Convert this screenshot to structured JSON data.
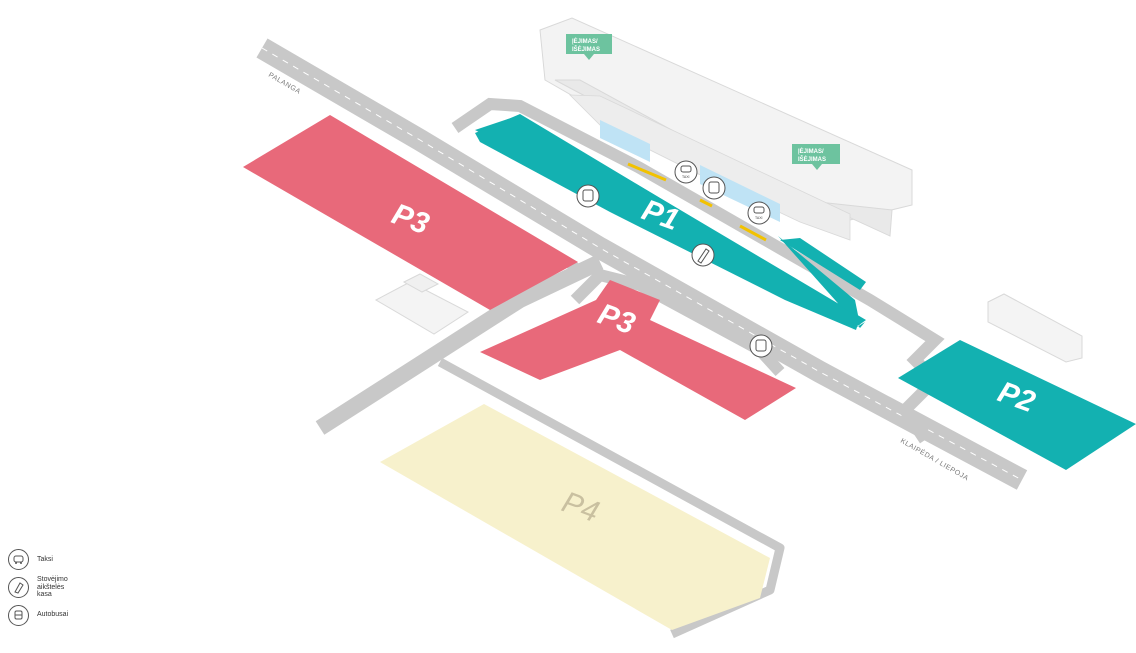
{
  "zones": {
    "p1": "P1",
    "p2": "P2",
    "p3_west": "P3",
    "p3_south": "P3",
    "p4": "P4"
  },
  "roads": {
    "north": "PALANGA",
    "south": "KLAIPĖDA / LIEPOJA"
  },
  "entrances": [
    {
      "line1": "ĮĖJIMAS/",
      "line2": "IŠĖJIMAS"
    },
    {
      "line1": "ĮĖJIMAS/",
      "line2": "IŠĖJIMAS"
    }
  ],
  "pins": {
    "taxi_text": "TAXI"
  },
  "legend": [
    {
      "icon": "taxi-icon",
      "label": "Taksi"
    },
    {
      "icon": "parking-ticket-icon",
      "label": "Stovėjimo\naikštelės\nkasa"
    },
    {
      "icon": "bus-icon",
      "label": "Autobusai"
    }
  ],
  "colors": {
    "p1_p2": "#13b1b1",
    "p3": "#e8697a",
    "p4": "#f7f1cc",
    "road": "#c8c8c8",
    "entrance": "#6dc39f",
    "building": "#f2f2f2"
  }
}
